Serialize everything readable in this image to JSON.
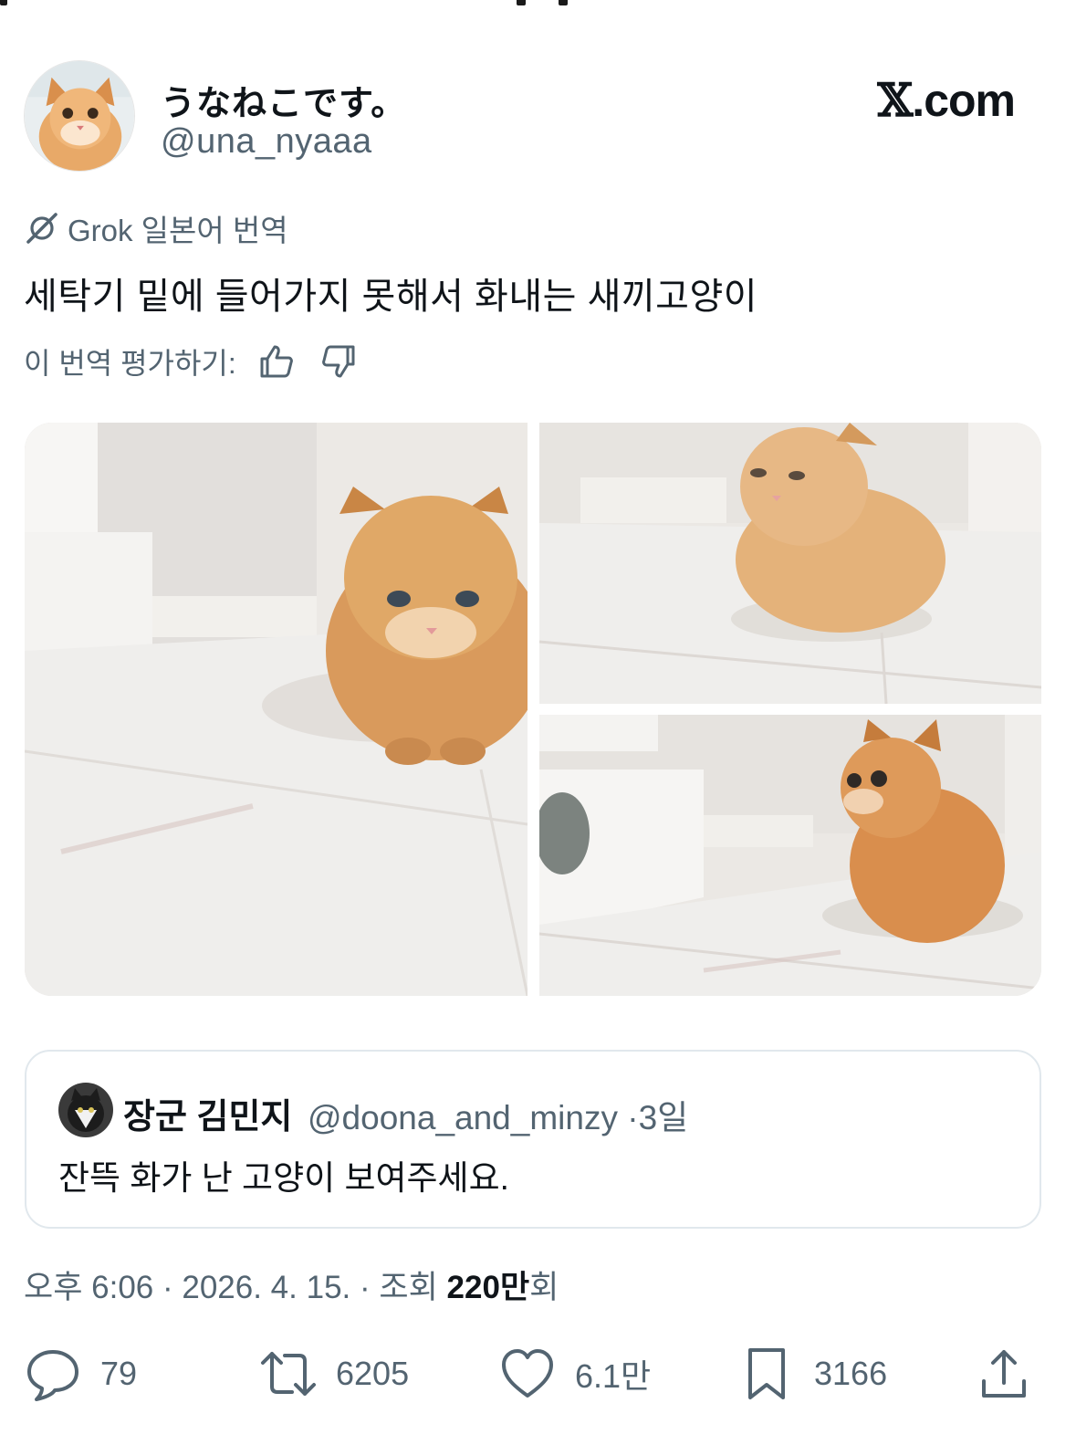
{
  "author": {
    "display_name": "うなねこです。",
    "handle": "@una_nyaaa"
  },
  "brand": {
    "x_glyph": "𝕏",
    "suffix": ".com"
  },
  "translation": {
    "label": "Grok 일본어 번역",
    "icon": "grok-icon"
  },
  "tweet": {
    "text": "세탁기 밑에 들어가지 못해서 화내는 새끼고양이"
  },
  "rating": {
    "label": "이 번역 평가하기:",
    "up_icon": "thumbs-up-icon",
    "down_icon": "thumbs-down-icon"
  },
  "media": {
    "count": 3
  },
  "quote": {
    "display_name": "장군 김민지",
    "handle": "@doona_and_minzy",
    "separator": "·",
    "age": "3일",
    "text": "잔뜩 화가 난 고양이 보여주세요."
  },
  "meta": {
    "time": "오후 6:06",
    "sep1": "·",
    "date": "2026. 4. 15.",
    "sep2": "·",
    "views_prefix": "조회",
    "views_number": "220",
    "views_unit": "만",
    "views_suffix": "회"
  },
  "actions": {
    "replies": "79",
    "reposts": "6205",
    "likes": "6.1만",
    "bookmarks": "3166"
  },
  "colors": {
    "text": "#0f1419",
    "muted": "#536471",
    "border": "#e1e8ed"
  }
}
